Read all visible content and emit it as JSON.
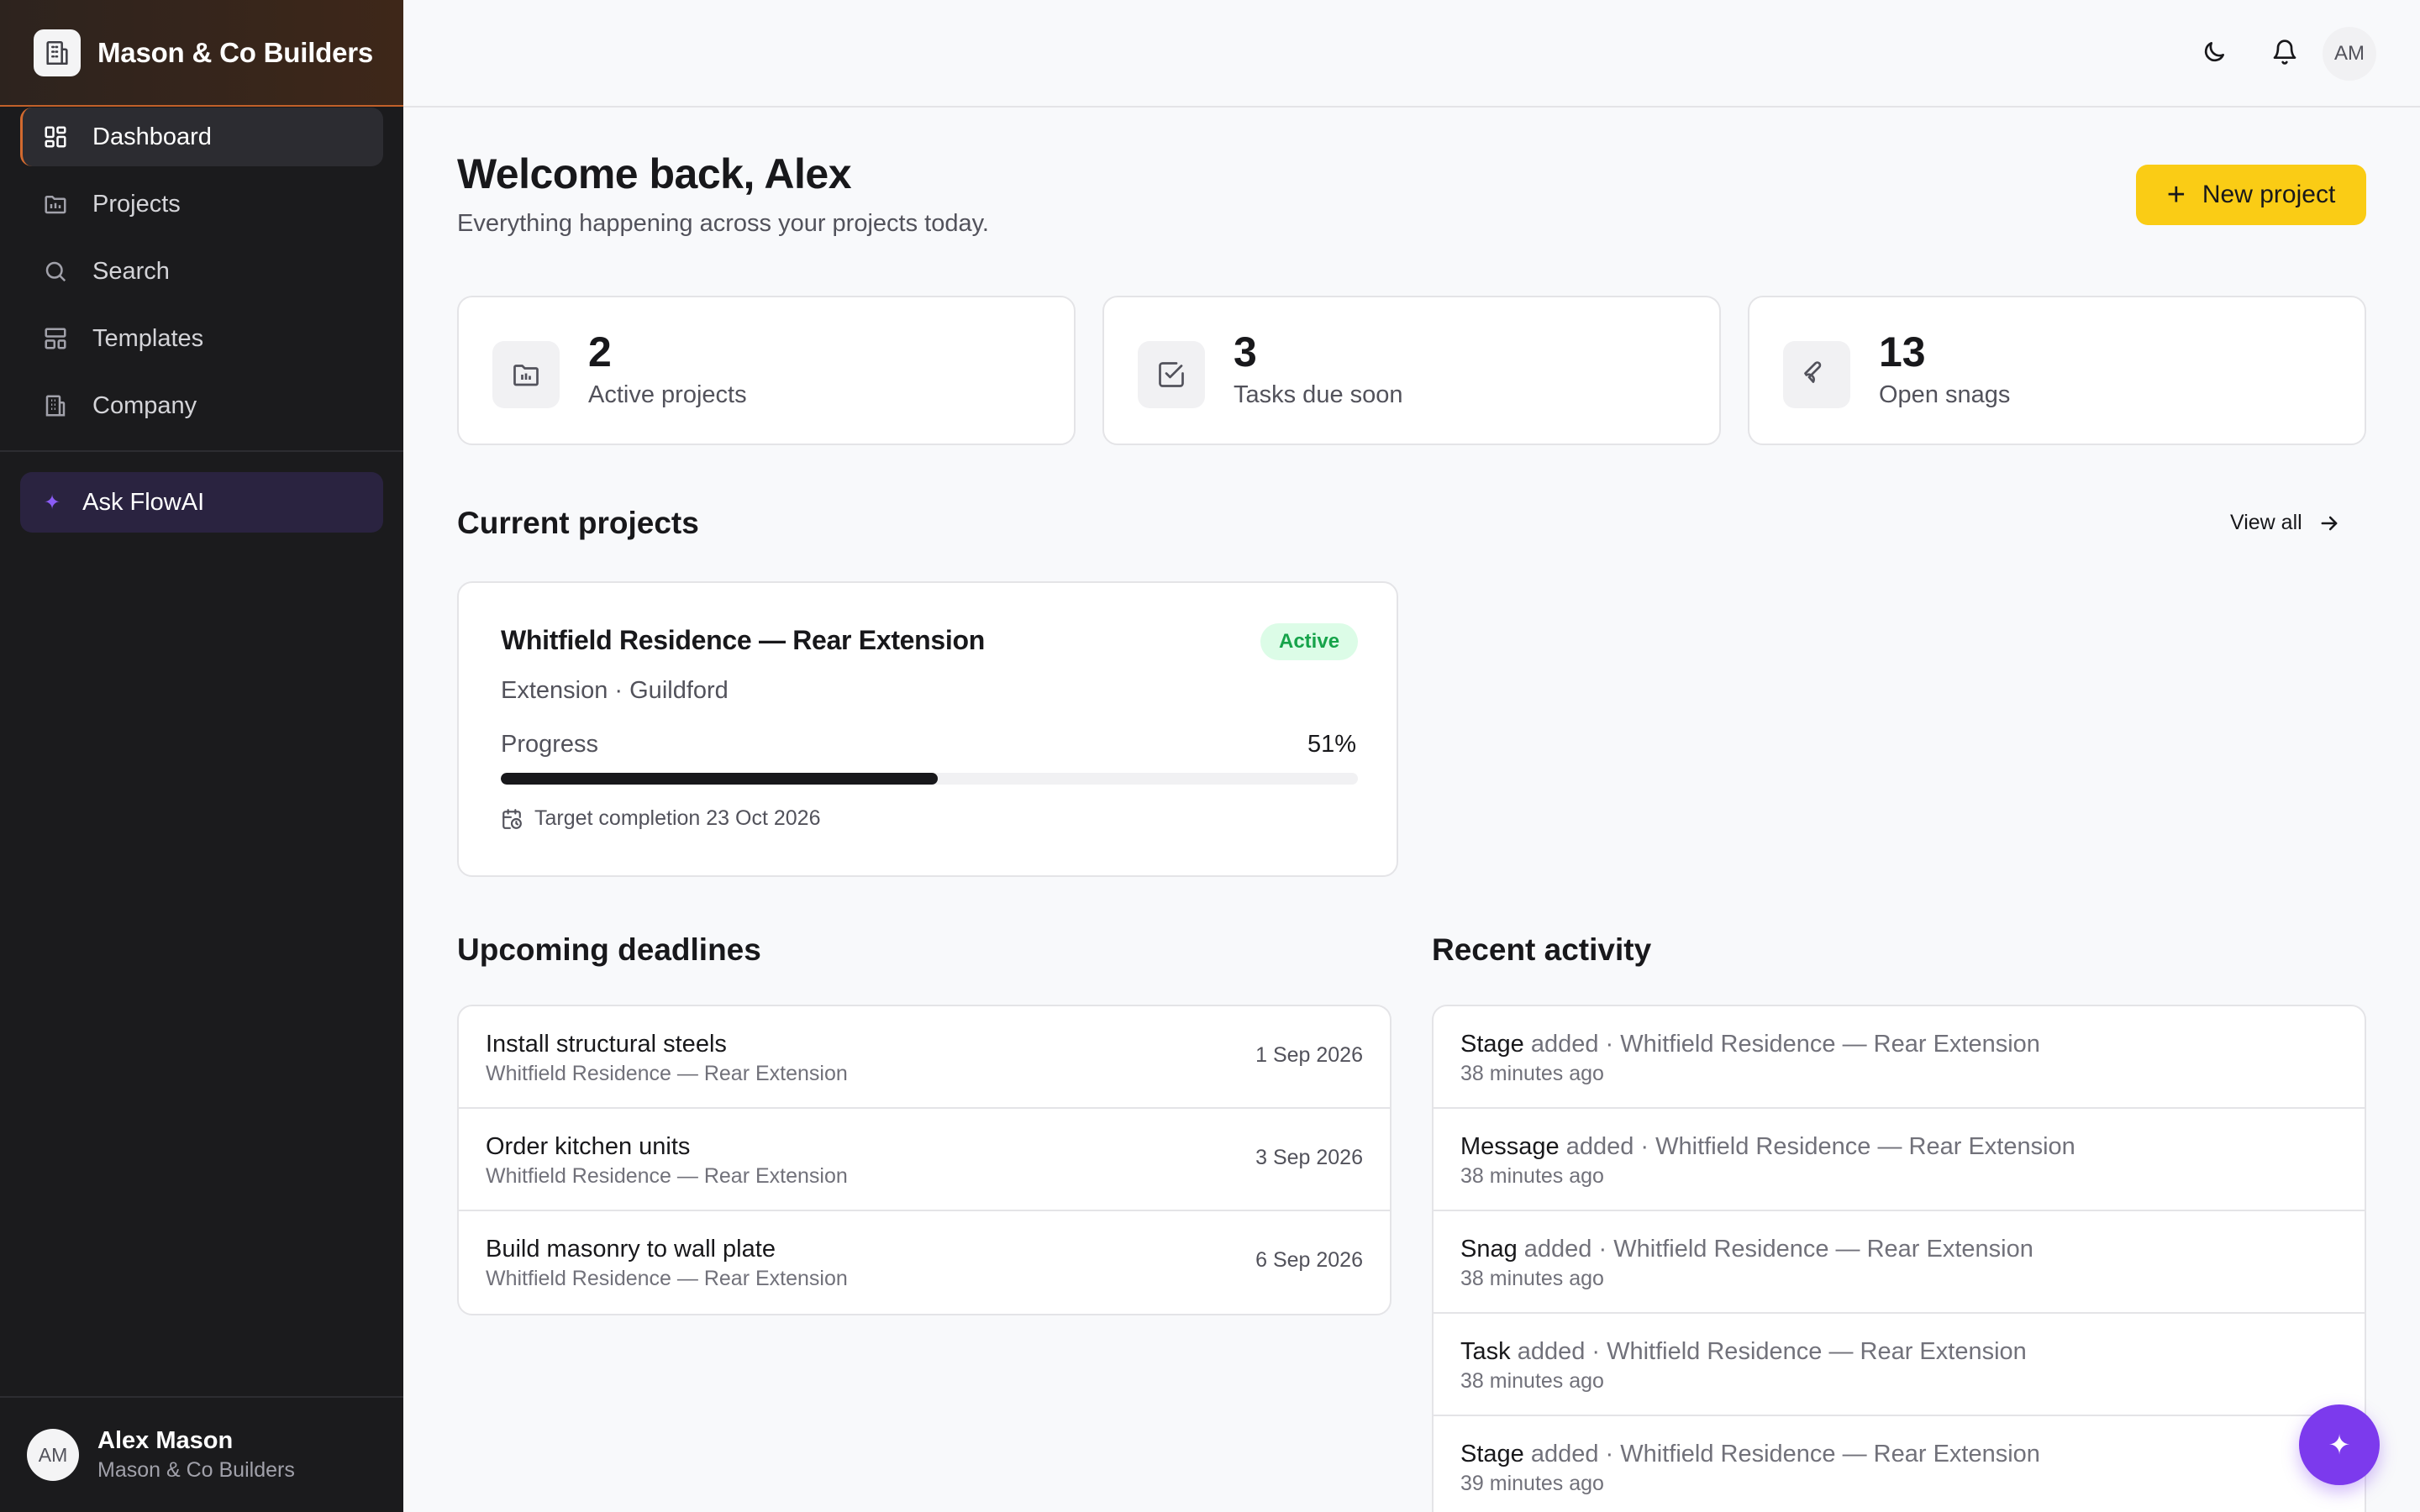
{
  "brand": {
    "name": "Mason & Co Builders"
  },
  "nav": {
    "items": [
      {
        "label": "Dashboard",
        "icon": "dashboard-icon",
        "active": true
      },
      {
        "label": "Projects",
        "icon": "projects-icon"
      },
      {
        "label": "Search",
        "icon": "search-icon"
      },
      {
        "label": "Templates",
        "icon": "templates-icon"
      },
      {
        "label": "Company",
        "icon": "company-icon"
      }
    ],
    "ask": "Ask FlowAI"
  },
  "user": {
    "initials": "AM",
    "name": "Alex Mason",
    "company": "Mason & Co Builders"
  },
  "topbar": {
    "avatar": "AM"
  },
  "header": {
    "title": "Welcome back, Alex",
    "subtitle": "Everything happening across your projects today.",
    "new_project": "New project"
  },
  "stats": [
    {
      "value": "2",
      "label": "Active projects",
      "icon": "folder-icon"
    },
    {
      "value": "3",
      "label": "Tasks due soon",
      "icon": "checkbox-icon"
    },
    {
      "value": "13",
      "label": "Open snags",
      "icon": "wrench-icon"
    }
  ],
  "current": {
    "title": "Current projects",
    "view_all": "View all",
    "project": {
      "name": "Whitfield Residence — Rear Extension",
      "status": "Active",
      "meta": "Extension · Guildford",
      "progress_label": "Progress",
      "progress_text": "51%",
      "progress": 51,
      "target": "Target completion 23 Oct 2026"
    }
  },
  "deadlines": {
    "title": "Upcoming deadlines",
    "items": [
      {
        "task": "Install structural steels",
        "project": "Whitfield Residence — Rear Extension",
        "date": "1 Sep 2026"
      },
      {
        "task": "Order kitchen units",
        "project": "Whitfield Residence — Rear Extension",
        "date": "3 Sep 2026"
      },
      {
        "task": "Build masonry to wall plate",
        "project": "Whitfield Residence — Rear Extension",
        "date": "6 Sep 2026"
      }
    ]
  },
  "activity": {
    "title": "Recent activity",
    "items": [
      {
        "kind": "Stage",
        "text": " added · Whitfield Residence — Rear Extension",
        "time": "38 minutes ago"
      },
      {
        "kind": "Message",
        "text": " added · Whitfield Residence — Rear Extension",
        "time": "38 minutes ago"
      },
      {
        "kind": "Snag",
        "text": " added · Whitfield Residence — Rear Extension",
        "time": "38 minutes ago"
      },
      {
        "kind": "Task",
        "text": " added · Whitfield Residence — Rear Extension",
        "time": "38 minutes ago"
      },
      {
        "kind": "Stage",
        "text": " added · Whitfield Residence — Rear Extension",
        "time": "39 minutes ago"
      }
    ]
  },
  "colors": {
    "accent": "#facc15",
    "ai": "#7c3aed",
    "active_badge": "#16a34a",
    "sidebar": "#1b1b1d"
  }
}
